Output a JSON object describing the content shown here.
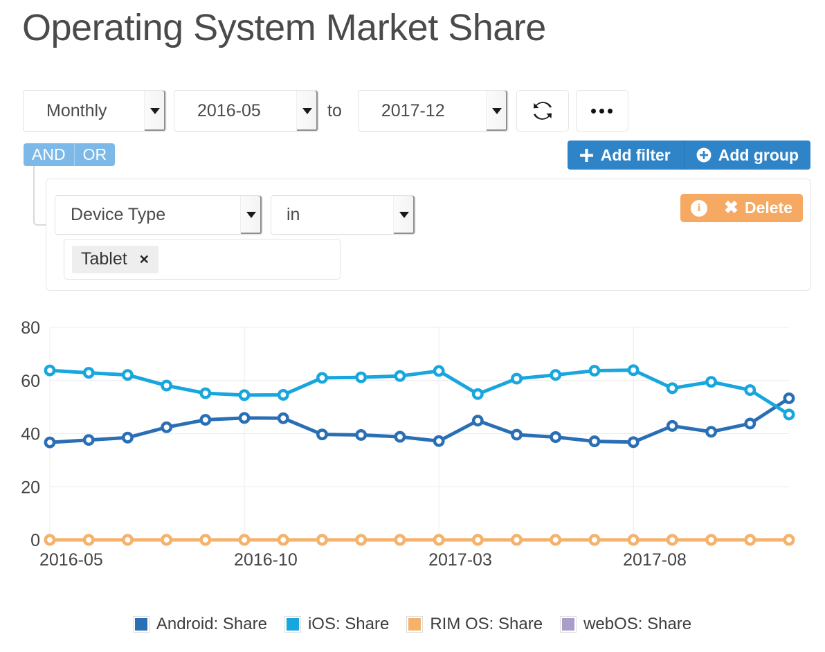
{
  "page": {
    "title": "Operating System Market Share"
  },
  "toolbar": {
    "period": "Monthly",
    "from": "2016-05",
    "to_label": "to",
    "to": "2017-12",
    "refresh_icon": "refresh-icon",
    "more_icon": "ellipsis-icon"
  },
  "filter_bar": {
    "add_filter_label": "Add filter",
    "add_group_label": "Add group",
    "add_filter_icon": "plus-icon",
    "add_group_icon": "plus-circle-icon",
    "logic": {
      "and": "AND",
      "or": "OR",
      "selected": "AND"
    }
  },
  "filter": {
    "field": "Device Type",
    "operator": "in",
    "values": [
      {
        "label": "Tablet",
        "remove_icon": "close-icon"
      }
    ],
    "info_icon": "info-circle-icon",
    "delete_icon": "close-icon",
    "delete_label": "Delete"
  },
  "chart_data": {
    "type": "line",
    "title": "",
    "xlabel": "",
    "ylabel": "",
    "ylim": [
      0,
      80
    ],
    "yticks": [
      0,
      20,
      40,
      60,
      80
    ],
    "grid": true,
    "legend_position": "bottom",
    "x": [
      "2016-05",
      "2016-06",
      "2016-07",
      "2016-08",
      "2016-09",
      "2016-10",
      "2016-11",
      "2016-12",
      "2017-01",
      "2017-02",
      "2017-03",
      "2017-04",
      "2017-05",
      "2017-06",
      "2017-07",
      "2017-08",
      "2017-09",
      "2017-10",
      "2017-11",
      "2017-12"
    ],
    "xtick_labels": [
      "2016-05",
      "2016-10",
      "2017-03",
      "2017-08"
    ],
    "xtick_indices": [
      0,
      5,
      10,
      15
    ],
    "series": [
      {
        "name": "Android: Share",
        "color": "#2a6fb5",
        "values": [
          36.7,
          37.6,
          38.5,
          42.4,
          45.2,
          45.9,
          45.8,
          39.7,
          39.5,
          38.8,
          37.2,
          44.9,
          39.6,
          38.7,
          37.1,
          36.8,
          42.9,
          40.7,
          43.8,
          53.3
        ]
      },
      {
        "name": "iOS: Share",
        "color": "#17a6dd",
        "values": [
          63.8,
          62.9,
          62.1,
          58.1,
          55.2,
          54.5,
          54.6,
          61.0,
          61.2,
          61.7,
          63.6,
          54.9,
          60.7,
          62.1,
          63.7,
          63.9,
          57.1,
          59.5,
          56.4,
          47.2
        ]
      },
      {
        "name": "RIM OS: Share",
        "color": "#f5b26b",
        "values": [
          0,
          0,
          0,
          0,
          0,
          0,
          0,
          0,
          0,
          0,
          0,
          0,
          0,
          0,
          0,
          0,
          0,
          0,
          0,
          0
        ]
      },
      {
        "name": "webOS: Share",
        "color": "#ab9cc9",
        "values": [
          0,
          0,
          0,
          0,
          0,
          0,
          0,
          0,
          0,
          0,
          0,
          0,
          0,
          0,
          0,
          0,
          0,
          0,
          0,
          0
        ]
      }
    ]
  }
}
